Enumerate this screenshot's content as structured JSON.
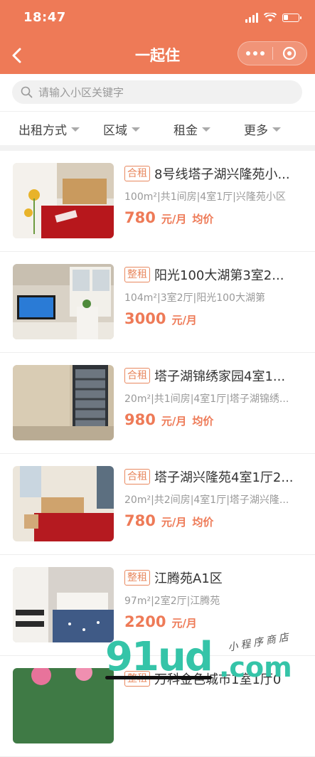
{
  "status": {
    "time": "18:47"
  },
  "nav": {
    "title": "一起住"
  },
  "search": {
    "placeholder": "请输入小区关键字"
  },
  "filters": [
    "出租方式",
    "区域",
    "租金",
    "更多"
  ],
  "colors": {
    "brand": "#ee7a57",
    "tag": "#e8885f",
    "text": "#333333",
    "muted": "#999999"
  },
  "listings": [
    {
      "tag": "合租",
      "name": "8号线塔子湖兴隆苑小...",
      "desc": "100m²|共1间房|4室1厅|兴隆苑小区",
      "price": "780",
      "unit": "元/月",
      "avg": "均价"
    },
    {
      "tag": "整租",
      "name": "阳光100大湖第3室2...",
      "desc": "104m²|3室2厅|阳光100大湖第",
      "price": "3000",
      "unit": "元/月",
      "avg": ""
    },
    {
      "tag": "合租",
      "name": "塔子湖锦绣家园4室1...",
      "desc": "20m²|共1间房|4室1厅|塔子湖锦绣...",
      "price": "980",
      "unit": "元/月",
      "avg": "均价"
    },
    {
      "tag": "合租",
      "name": "塔子湖兴隆苑4室1厅2...",
      "desc": "20m²|共2间房|4室1厅|塔子湖兴隆...",
      "price": "780",
      "unit": "元/月",
      "avg": "均价"
    },
    {
      "tag": "整租",
      "name": "江腾苑A1区",
      "desc": "97m²|2室2厅|江腾苑",
      "price": "2200",
      "unit": "元/月",
      "avg": ""
    },
    {
      "tag": "整租",
      "name": "万科金色城市1室1厅0",
      "desc": "",
      "price": "",
      "unit": "",
      "avg": ""
    }
  ],
  "watermark": {
    "brand": "91ud",
    "domain": ".com",
    "sub": "小程序商店"
  }
}
